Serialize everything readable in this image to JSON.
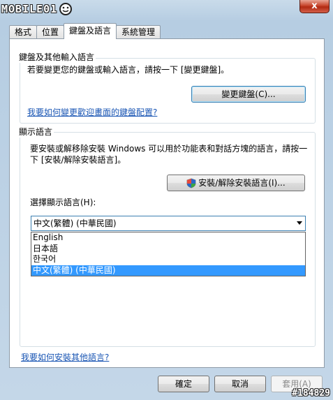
{
  "header": {
    "logo_text": "MOBILE01",
    "close_label": "x"
  },
  "tabs": [
    {
      "label": "格式"
    },
    {
      "label": "位置"
    },
    {
      "label": "鍵盤及語言",
      "active": true
    },
    {
      "label": "系統管理"
    }
  ],
  "keyboard_group": {
    "title": "鍵盤及其他輸入語言",
    "description": "若要變更您的鍵盤或輸入語言，請按一下 [變更鍵盤]。",
    "change_button": "變更鍵盤(C)...",
    "welcome_link": "我要如何變更歡迎畫面的鍵盤配置?"
  },
  "display_group": {
    "title": "顯示語言",
    "description_line1": "要安裝或解移除安裝 Windows 可以用於功能表和對話方塊的語言，請按一",
    "description_line2": "下 [安裝/解除安裝語言]。",
    "install_button": "安裝/解除安裝語言(I)...",
    "select_label": "選擇顯示語言(H):",
    "selected_value": "中文(繁體) (中華民國)",
    "options": [
      "English",
      "日本語",
      "한국어",
      "中文(繁體) (中華民國)"
    ],
    "selected_index": 3
  },
  "footer": {
    "install_more_link": "我要如何安裝其他語言?",
    "ok_button": "確定",
    "cancel_button": "取消",
    "apply_button": "套用(A)"
  },
  "watermark": "#184829",
  "colors": {
    "link": "#1a56b4",
    "selection": "#3399ff",
    "titlebar": "#b6cde2"
  },
  "icons": {
    "shield": "uac-shield-icon"
  }
}
